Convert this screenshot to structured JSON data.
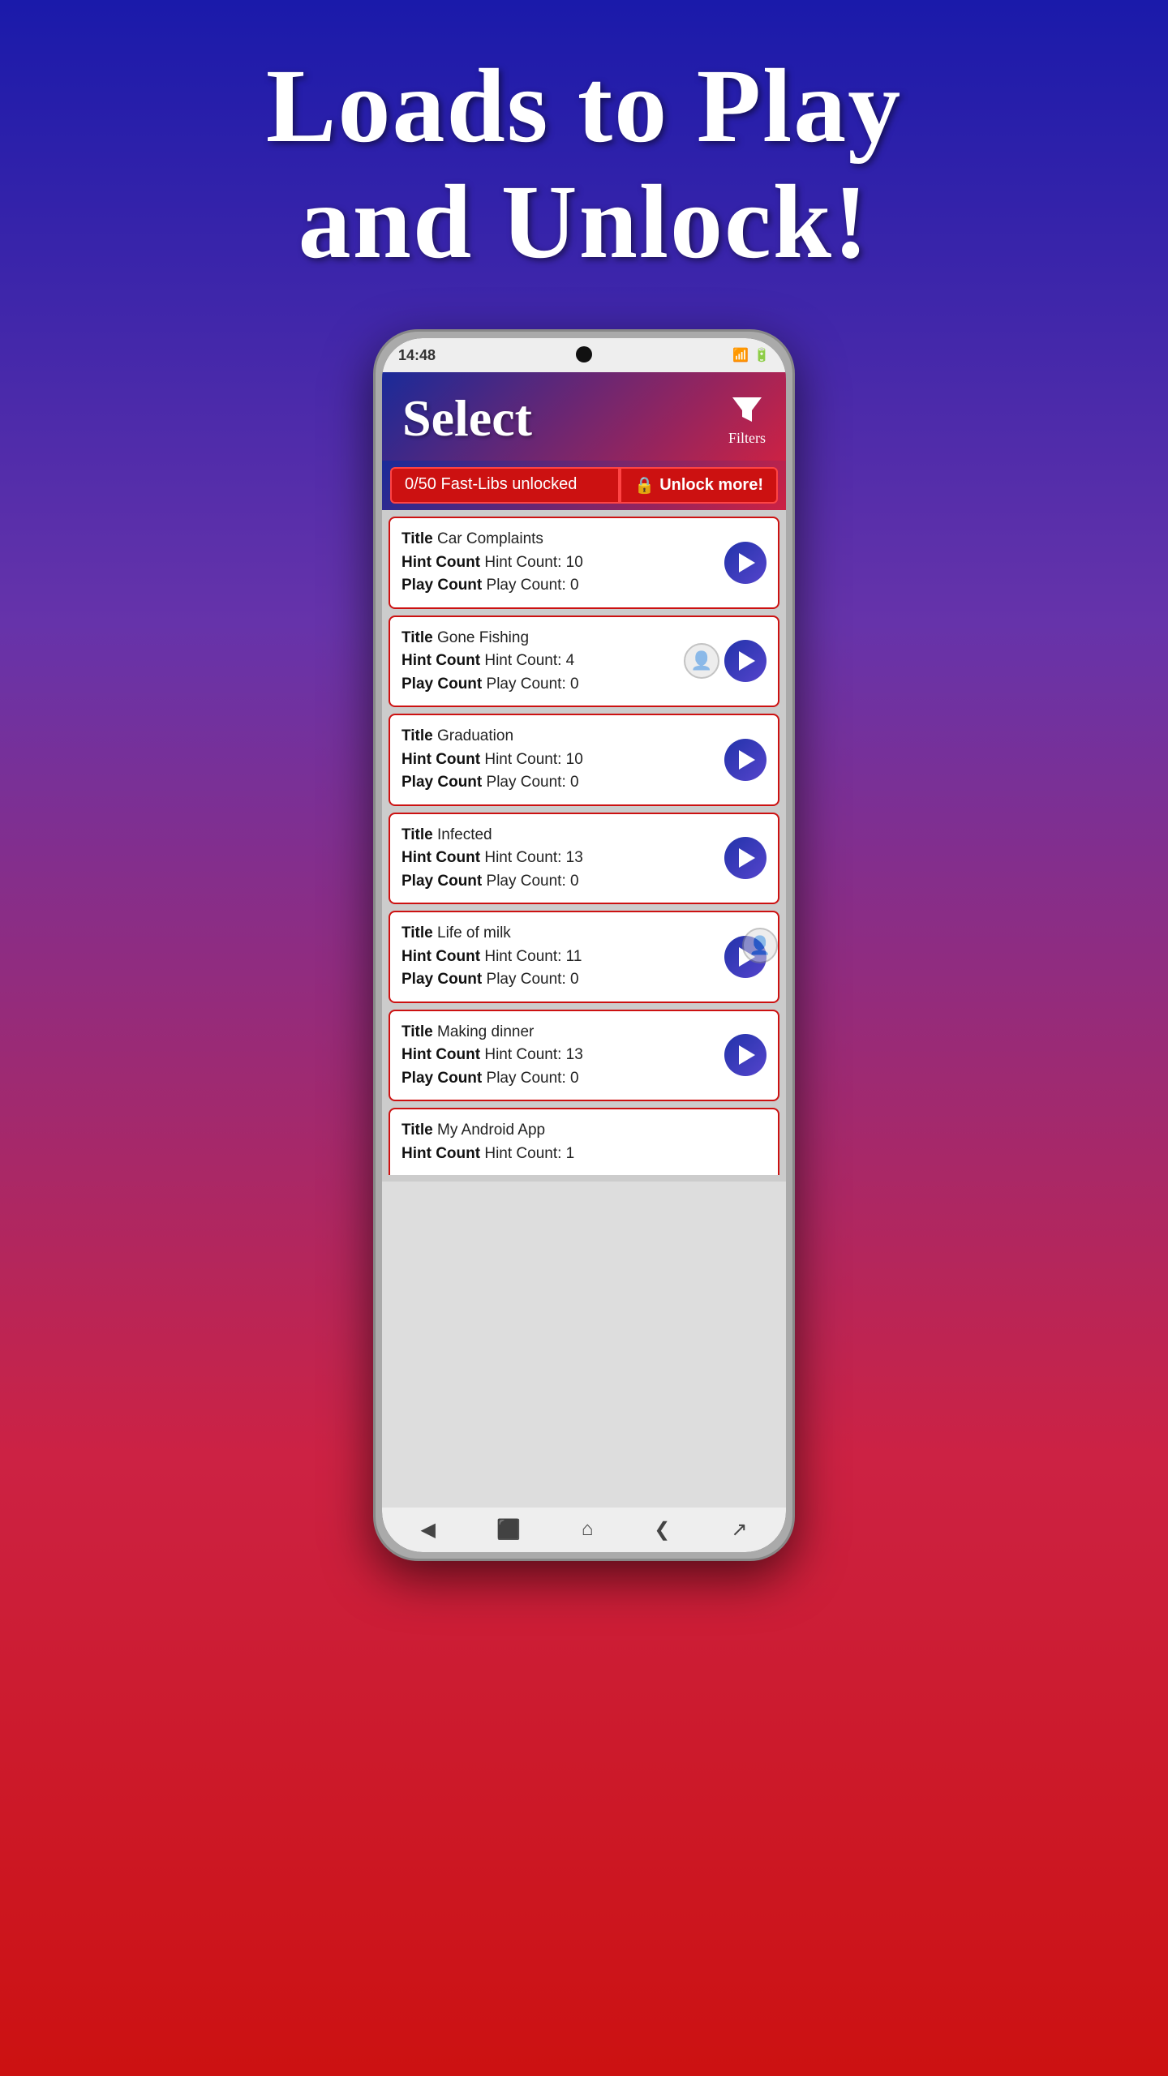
{
  "headline": {
    "line1": "Loads to Play",
    "line2": "and Unlock!"
  },
  "status_bar": {
    "time": "14:48",
    "icons": "📶 🔋"
  },
  "app": {
    "title": "Select",
    "filter_label": "Filters",
    "unlock_count": "0/50 Fast-Libs unlocked",
    "unlock_more": "Unlock more!",
    "lock_icon": "🔒"
  },
  "items": [
    {
      "title": "Car Complaints",
      "hint_count": "10",
      "play_count": "0",
      "user_created": false
    },
    {
      "title": "Gone Fishing",
      "hint_count": "4",
      "play_count": "0",
      "user_created": true
    },
    {
      "title": "Graduation",
      "hint_count": "10",
      "play_count": "0",
      "user_created": false
    },
    {
      "title": "Infected",
      "hint_count": "13",
      "play_count": "0",
      "user_created": false
    },
    {
      "title": "Life of milk",
      "hint_count": "11",
      "play_count": "0",
      "user_created": false
    },
    {
      "title": "Making dinner",
      "hint_count": "13",
      "play_count": "0",
      "user_created": false
    },
    {
      "title": "My Android App",
      "hint_count": "1",
      "play_count": null,
      "user_created": true,
      "partial": true
    }
  ],
  "labels": {
    "title": "Title",
    "hint_count": "Hint Count",
    "play_count": "Play Count",
    "hint_prefix": "Hint Count: ",
    "play_prefix": "Play Count: "
  },
  "nav": {
    "back": "◀",
    "home": "⌂",
    "recent": "▣",
    "nav_back": "❮",
    "share": "↗"
  }
}
